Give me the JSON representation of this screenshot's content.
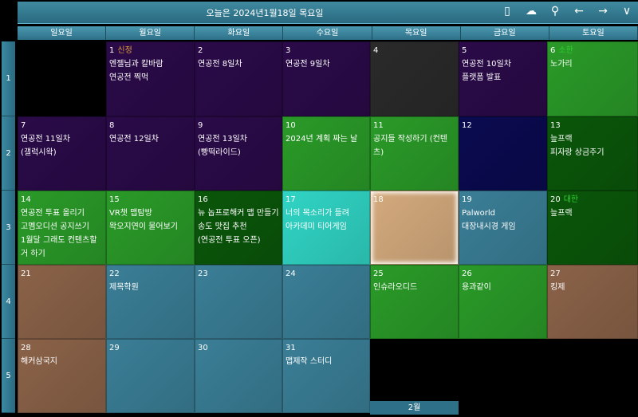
{
  "header": {
    "title": "오늘은 2024년1월18일 목요일",
    "icons": [
      "phone-icon",
      "cloud-check-icon",
      "user-icon",
      "arrow-left-icon",
      "arrow-right-icon",
      "chevron-down-icon"
    ],
    "glyphs": [
      "▯",
      "☁",
      "⚲",
      "←",
      "→",
      "∨"
    ]
  },
  "weekdays": [
    "일요일",
    "월요일",
    "화요일",
    "수요일",
    "목요일",
    "금요일",
    "토요일"
  ],
  "weeks": [
    "1",
    "2",
    "3",
    "4",
    "5"
  ],
  "next_month_label": "2월",
  "colors": {
    "purple": "#2a0a48",
    "black": "#000000",
    "gray": "#2a2a2a",
    "green": "#2a9a28",
    "darkgreen": "#0a560a",
    "navy": "#0a0a50",
    "cyan": "#30d4c4",
    "tan": "#d4aa7d",
    "teal": "#3a7e96",
    "brown": "#8a6248",
    "holiday_orange": "#e0a040",
    "holiday_green": "#30d030"
  },
  "cells": [
    {
      "day": "",
      "color": "black",
      "events": []
    },
    {
      "day": "1",
      "holiday": "신정",
      "hcolor": "holiday_orange",
      "color": "purple",
      "events": [
        "엔젤님과 칼바람",
        "연공전 찍먹"
      ]
    },
    {
      "day": "2",
      "color": "purple",
      "events": [
        "연공전 8일차"
      ]
    },
    {
      "day": "3",
      "color": "purple",
      "events": [
        "연공전 9일차"
      ]
    },
    {
      "day": "4",
      "color": "gray",
      "events": []
    },
    {
      "day": "5",
      "color": "purple",
      "events": [
        "연공전 10일차",
        "플랫폼 발표"
      ]
    },
    {
      "day": "6",
      "holiday": "소한",
      "hcolor": "holiday_green",
      "color": "green",
      "events": [
        "노가리"
      ]
    },
    {
      "day": "7",
      "color": "purple",
      "events": [
        "연공전 11일차",
        "(갤럭시왁)"
      ]
    },
    {
      "day": "8",
      "color": "purple",
      "events": [
        "연공전 12일차"
      ]
    },
    {
      "day": "9",
      "color": "purple",
      "events": [
        "연공전 13일차",
        "(빵떡라이드)"
      ]
    },
    {
      "day": "10",
      "color": "green",
      "events": [
        "2024년 계획 짜는 날"
      ]
    },
    {
      "day": "11",
      "color": "green",
      "events": [
        "공지들 작성하기 (컨텐츠)"
      ]
    },
    {
      "day": "12",
      "color": "navy",
      "events": []
    },
    {
      "day": "13",
      "color": "darkgreen",
      "events": [
        "늪프랙",
        "피자랑 상금주기"
      ]
    },
    {
      "day": "14",
      "color": "green",
      "events": [
        "연공전 투표 올리기",
        "고멤오디션 공지쓰기",
        "1월달 그래도 컨텐츠할 거 하기"
      ]
    },
    {
      "day": "15",
      "color": "green",
      "events": [
        "VR챗 맵탐방",
        "왁오지연이 물어보기"
      ]
    },
    {
      "day": "16",
      "color": "darkgreen",
      "events": [
        "뉴 놉프로해커 맵 만들기",
        "송도 맛집 추천",
        "(연공전 투표 오픈)"
      ]
    },
    {
      "day": "17",
      "color": "cyan",
      "events": [
        "너의 목소리가 들려",
        "아카데미 티어게임"
      ]
    },
    {
      "day": "18",
      "color": "tan",
      "today": true,
      "events": []
    },
    {
      "day": "19",
      "color": "teal",
      "events": [
        "Palworld",
        "대장내시경 게임"
      ]
    },
    {
      "day": "20",
      "holiday": "대한",
      "hcolor": "holiday_green",
      "color": "darkgreen",
      "events": [
        "늪프랙"
      ]
    },
    {
      "day": "21",
      "color": "brown",
      "events": []
    },
    {
      "day": "22",
      "color": "teal",
      "events": [
        "제목학원"
      ]
    },
    {
      "day": "23",
      "color": "teal",
      "events": []
    },
    {
      "day": "24",
      "color": "teal",
      "events": []
    },
    {
      "day": "25",
      "color": "green",
      "events": [
        "인슈라오디드"
      ]
    },
    {
      "day": "26",
      "color": "green",
      "events": [
        "용과같이"
      ]
    },
    {
      "day": "27",
      "color": "brown",
      "events": [
        "킹제"
      ]
    },
    {
      "day": "28",
      "color": "brown",
      "events": [
        "해커삼국지"
      ]
    },
    {
      "day": "29",
      "color": "teal",
      "events": []
    },
    {
      "day": "30",
      "color": "teal",
      "events": []
    },
    {
      "day": "31",
      "color": "teal",
      "events": [
        "맵제작 스터디"
      ]
    },
    {
      "day": "",
      "color": "black",
      "events": []
    },
    {
      "day": "",
      "color": "black",
      "events": []
    },
    {
      "day": "",
      "color": "black",
      "events": []
    }
  ]
}
